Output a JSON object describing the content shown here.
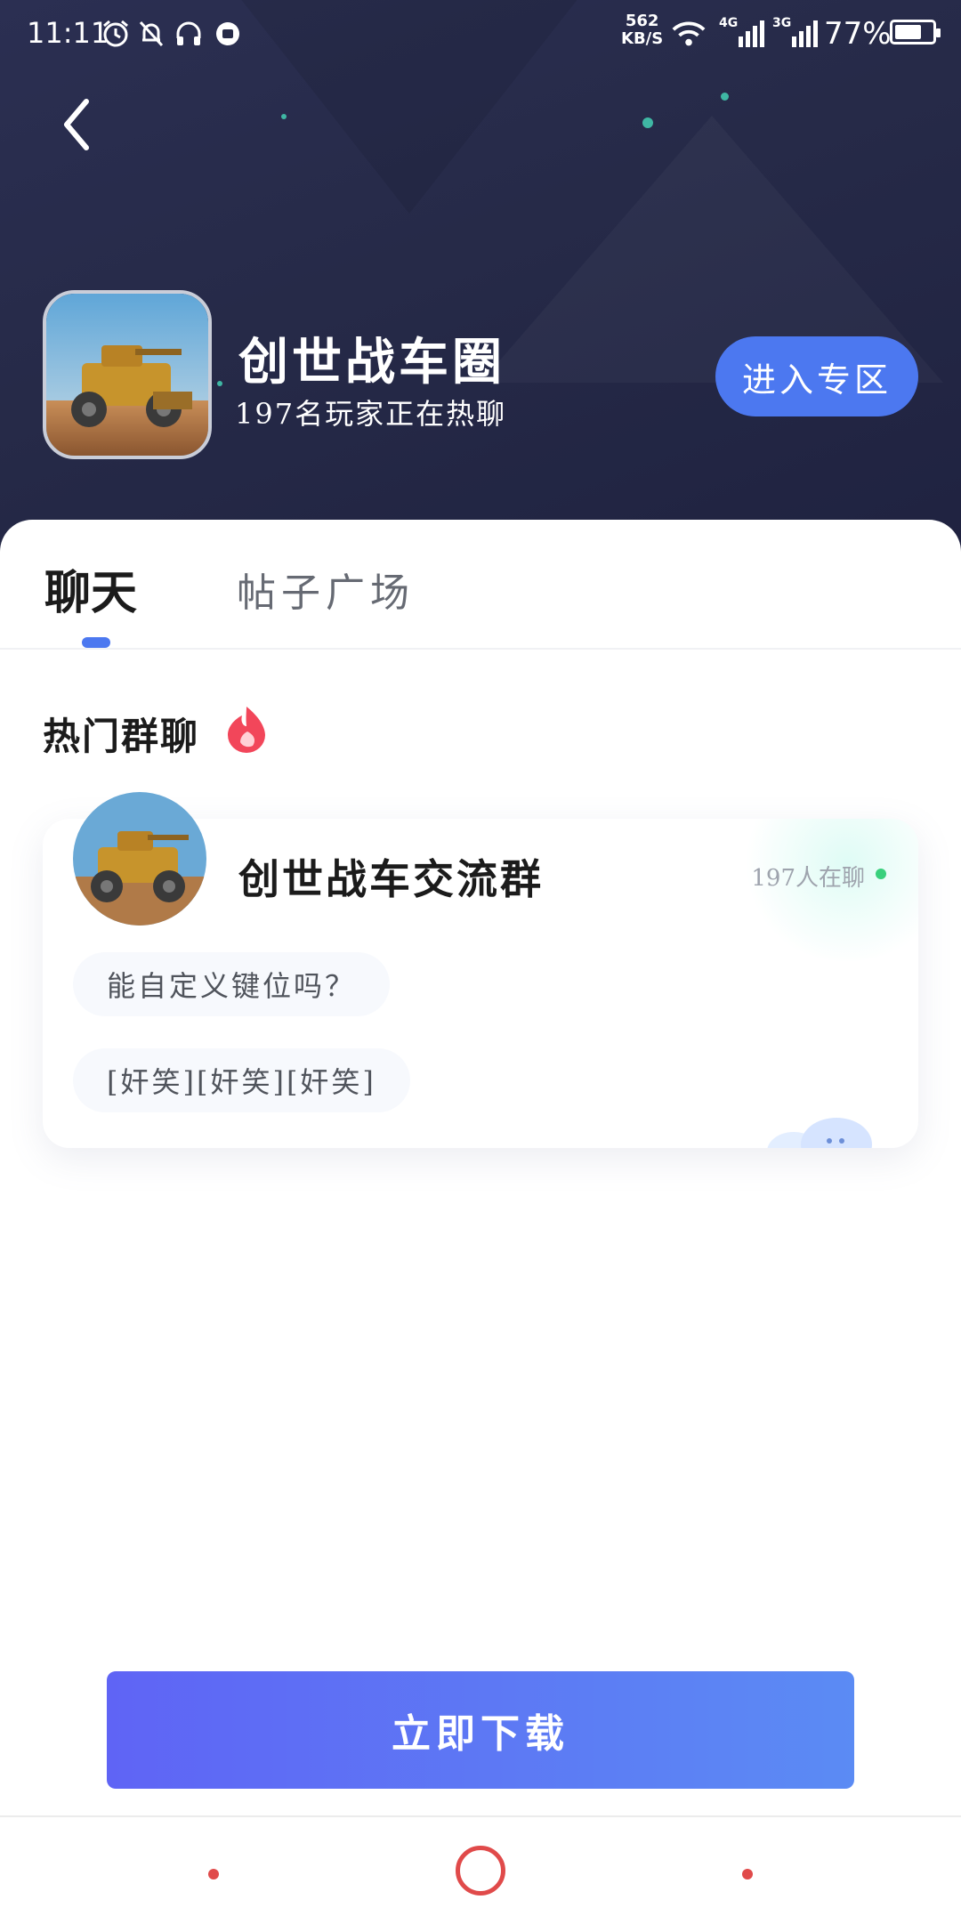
{
  "status_bar": {
    "time": "11:11",
    "net_speed_value": "562",
    "net_speed_unit": "KB/S",
    "network_1": "4G",
    "network_2": "3G",
    "battery_text": "77%",
    "battery_level": 0.77,
    "icons": [
      "alarm-icon",
      "bell-off-icon",
      "headphones-icon",
      "app-notification-icon",
      "wifi-icon",
      "signal-icon",
      "battery-icon"
    ]
  },
  "header": {
    "back_icon": "chevron-left-icon",
    "app_name": "创世战车圈",
    "subtitle": "197名玩家正在热聊",
    "enter_button": "进入专区"
  },
  "tabs": [
    {
      "label": "聊天",
      "active": true
    },
    {
      "label": "帖子广场",
      "active": false
    }
  ],
  "hot_groups": {
    "title": "热门群聊",
    "icon": "fire-icon",
    "cards": [
      {
        "name": "创世战车交流群",
        "online": "197人在聊",
        "messages": [
          "能自定义键位吗？",
          "[奸笑][奸笑][奸笑]"
        ]
      }
    ]
  },
  "download_button": "立即下载",
  "colors": {
    "accent": "#4c78f0",
    "header_bg": "#262a48",
    "online_green": "#39d07c",
    "nav_red": "#e04a4a"
  }
}
